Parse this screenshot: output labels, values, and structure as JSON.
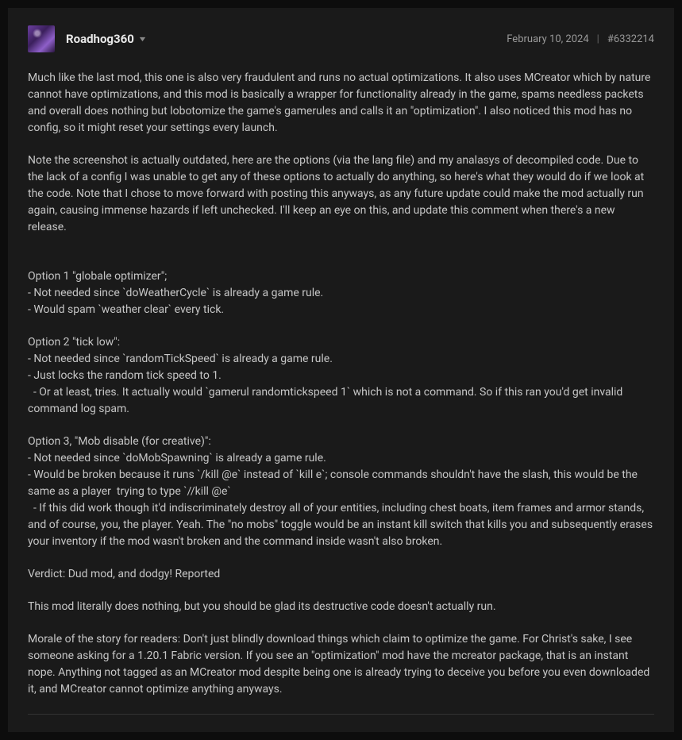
{
  "header": {
    "username": "Roadhog360",
    "date": "February 10, 2024",
    "post_id": "#6332214"
  },
  "body": {
    "para1": "Much like the last mod, this one is also very fraudulent and runs no actual optimizations. It also uses MCreator which by nature cannot have optimizations, and this mod is basically a wrapper for functionality already in the game, spams needless packets and overall does nothing but lobotomize the game's gamerules and calls it an \"optimization\". I also noticed this mod has no config, so it might reset your settings every launch.",
    "para2": "Note the screenshot is actually outdated, here are the options (via the lang file) and my analasys of decompiled code. Due to the lack of a config I was unable to get any of these options to actually do anything, so here's what they would do if we look at the code. Note that I chose to move forward with posting this anyways, as any future update could make the mod actually run again, causing immense hazards if left unchecked. I'll keep an eye on this, and update this comment when there's a new release.",
    "option1": {
      "title": "Option 1 \"globale optimizer\";",
      "line1": "- Not needed since `doWeatherCycle` is already a game rule.",
      "line2": "- Would spam `weather clear` every tick."
    },
    "option2": {
      "title": "Option 2 \"tick low\":",
      "line1": "- Not needed since `randomTickSpeed` is already a game rule.",
      "line2": "- Just locks the random tick speed to 1.",
      "line3": "  - Or at least, tries. It actually would `gamerul randomtickspeed 1` which is not a command. So if this ran you'd get invalid command log spam."
    },
    "option3": {
      "title": "Option 3, \"Mob disable (for creative)\":",
      "line1": "- Not needed since `doMobSpawning` is already a game rule.",
      "line2": "- Would be broken because it runs `/kill @e` instead of `kill e`; console commands shouldn't have the slash, this would be the same as a player  trying to type `//kill @e`",
      "line3": "  - If this did work though it'd indiscriminately destroy all of your entities, including chest boats, item frames and armor stands, and of course, you, the player. Yeah. The \"no mobs\" toggle would be an instant kill switch that kills you and subsequently erases your inventory if the mod wasn't broken and the command inside wasn't also broken."
    },
    "verdict": "Verdict: Dud mod, and dodgy! Reported",
    "para3": "This mod literally does nothing, but you should be glad its destructive code doesn't actually run.",
    "para4": "Morale of the story for readers: Don't just blindly download things which claim to optimize the game. For Christ's sake, I see someone asking for a 1.20.1 Fabric version. If you see an \"optimization\" mod have the mcreator package, that is an instant nope. Anything not tagged as an MCreator mod despite being one is already trying to deceive you before you even downloaded it, and MCreator cannot optimize anything anyways."
  }
}
